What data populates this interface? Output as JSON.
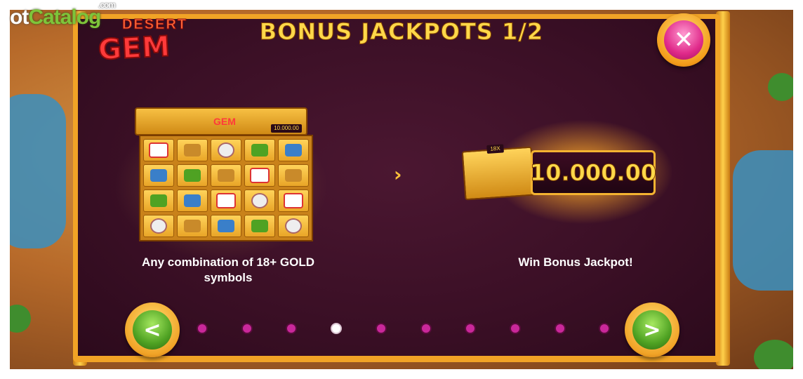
{
  "watermark": {
    "part1": "ot",
    "part2": "Catalog",
    "suffix": ".com"
  },
  "game_logo": {
    "top_word": "DESERT",
    "main_word": "GEM"
  },
  "title": "BONUS JACKPOTS 1/2",
  "close_button": {
    "icon": "close-icon",
    "glyph": "✕"
  },
  "left_panel": {
    "grid_amount": "10.000.00",
    "grid_logo_word": "GEM",
    "description_line1": "Any combination of 18+ GOLD",
    "description_line2": "symbols"
  },
  "arrow_glyph": "›",
  "right_panel": {
    "mini_tag": "18X",
    "jackpot_value": "10.000.00",
    "description": "Win Bonus Jackpot!"
  },
  "navigation": {
    "prev_glyph": "<",
    "next_glyph": ">",
    "page_count": 10,
    "active_page": 4
  },
  "colors": {
    "panel": "#3a0f25",
    "frame": "#f1a326",
    "title": "#ffd84a",
    "dot_inactive": "#c9289a",
    "dot_active": "#ffffff",
    "nav_green": "#4fa223",
    "close_pink": "#e02a8a"
  }
}
